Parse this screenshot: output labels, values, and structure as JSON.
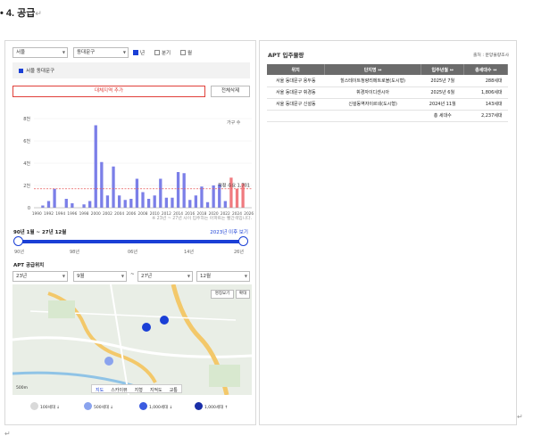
{
  "heading": {
    "title": "• 4. 공급",
    "para_mark": "↵"
  },
  "filters": {
    "region": "서울",
    "district": "동대문구",
    "period_options": [
      {
        "label": "년",
        "checked": true
      },
      {
        "label": "분기",
        "checked": false
      },
      {
        "label": "월",
        "checked": false
      }
    ]
  },
  "selected_area": "서울 동대문구",
  "buttons": {
    "add_compare": "대체지역 추가",
    "delete_all": "전체삭제"
  },
  "chart": {
    "unit_label": "가구 수",
    "y_ticks": [
      "8천",
      "6천",
      "4천",
      "2천",
      "0"
    ],
    "ref_label": "적정 수요 1,701",
    "note": "※ 23년 ~ 27년 사이 입주하는 아파트는 빨간색입니다."
  },
  "chart_data": {
    "type": "bar",
    "x": [
      "1990",
      "1991",
      "1992",
      "1993",
      "1994",
      "1995",
      "1996",
      "1997",
      "1998",
      "1999",
      "2000",
      "2001",
      "2002",
      "2003",
      "2004",
      "2005",
      "2006",
      "2007",
      "2008",
      "2009",
      "2010",
      "2011",
      "2012",
      "2013",
      "2014",
      "2015",
      "2016",
      "2017",
      "2018",
      "2019",
      "2020",
      "2021",
      "2022",
      "2023",
      "2024",
      "2025",
      "2026"
    ],
    "x_tick_labels": [
      "1990",
      "1992",
      "1994",
      "1996",
      "1998",
      "2000",
      "2002",
      "2004",
      "2006",
      "2008",
      "2010",
      "2012",
      "2014",
      "2016",
      "2018",
      "2020",
      "2022",
      "2024",
      "2026"
    ],
    "values": [
      0,
      200,
      600,
      1700,
      0,
      800,
      400,
      0,
      300,
      600,
      7400,
      4100,
      1100,
      3700,
      1100,
      700,
      800,
      2600,
      1400,
      800,
      1100,
      2600,
      900,
      900,
      3200,
      3100,
      700,
      1100,
      1900,
      500,
      2000,
      2100,
      600,
      2700,
      1700,
      2200,
      0
    ],
    "highlight_range": [
      "2023",
      "2027"
    ],
    "reference_line": 1701,
    "ylim": [
      0,
      8000
    ],
    "colors": {
      "normal": "#7b7fe8",
      "highlight": "#f07b80",
      "reference": "#e65b5b"
    }
  },
  "range": {
    "label": "90년 1월 ~ 27년 12월",
    "link": "2023년 이후 보기",
    "ticks": [
      "90년",
      "98년",
      "06년",
      "14년",
      "26년"
    ],
    "start_fraction": 0.0,
    "end_fraction": 1.0
  },
  "supply_location": {
    "title": "APT 공급위치",
    "from_year": "23년",
    "from_month": "9월",
    "separator": "~",
    "to_year": "27년",
    "to_month": "12월"
  },
  "map": {
    "tabs": [
      "지도",
      "스카이뷰",
      "지형",
      "지적도",
      "교통"
    ],
    "buttons": [
      "명칭묘기",
      "확대"
    ],
    "scale": "500m"
  },
  "map_legend": [
    "100세대 ↓",
    "500세대 ↓",
    "1,000세대 ↓",
    "1,000세대 ↑"
  ],
  "table": {
    "title": "APT 입주물량",
    "source": "출처 : 분양물량조사",
    "headers": [
      "위치",
      "단지명 ↔",
      "입주년월 ↔",
      "총세대수 ↔"
    ],
    "rows": [
      [
        "서울 동대문구 용두동",
        "힐스테이트청량리메트로블(도시형)",
        "2025년 7월",
        "288세대"
      ],
      [
        "서울 동대문구 휘경동",
        "휘경자이디센시아",
        "2025년 6월",
        "1,806세대"
      ],
      [
        "서울 동대문구 신설동",
        "신설동역자이르네(도시형)",
        "2024년 11월",
        "143세대"
      ],
      [
        "",
        "",
        "총 세대수",
        "2,237세대"
      ]
    ]
  }
}
